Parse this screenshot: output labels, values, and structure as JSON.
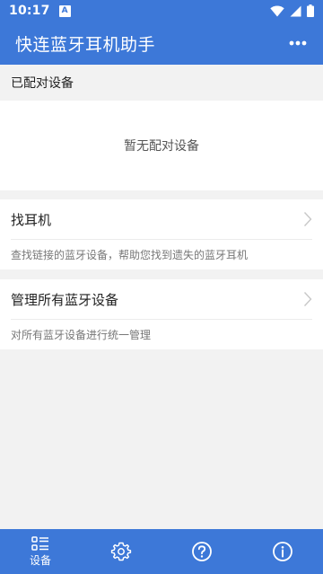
{
  "status_bar": {
    "time": "10:17",
    "app_badge": "A"
  },
  "app_bar": {
    "title": "快连蓝牙耳机助手",
    "menu_icon": "more-vert-icon"
  },
  "paired_section": {
    "header": "已配对设备",
    "empty_text": "暂无配对设备"
  },
  "cards": [
    {
      "title": "找耳机",
      "description": "查找链接的蓝牙设备，帮助您找到遗失的蓝牙耳机"
    },
    {
      "title": "管理所有蓝牙设备",
      "description": "对所有蓝牙设备进行统一管理"
    }
  ],
  "bottom_nav": {
    "devices_label": "设备",
    "items": [
      "devices-icon",
      "settings-icon",
      "help-icon",
      "info-icon"
    ]
  },
  "colors": {
    "primary": "#3d78d8",
    "background": "#f2f2f2"
  }
}
